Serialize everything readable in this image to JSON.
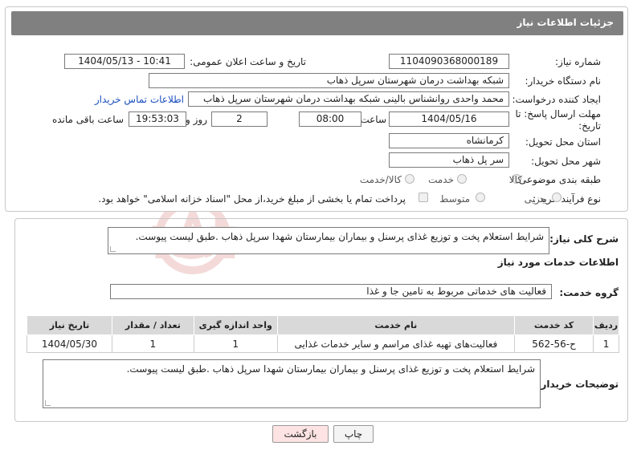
{
  "header": {
    "title": "جزئیات اطلاعات نیاز"
  },
  "form": {
    "need_number_label": "شماره نیاز:",
    "need_number": "1104090368000189",
    "announce_label": "تاریخ و ساعت اعلان عمومی:",
    "announce_value": "1404/05/13 - 10:41",
    "buyer_org_label": "نام دستگاه خریدار:",
    "buyer_org": "شبکه بهداشت درمان شهرستان سرپل ذهاب",
    "requester_label": "ایجاد کننده درخواست:",
    "requester": "محمد واحدی روانشناس بالینی شبکه بهداشت درمان شهرستان سرپل ذهاب",
    "contact_link": "اطلاعات تماس خریدار",
    "deadline_label_1": "مهلت ارسال پاسخ: تا",
    "deadline_label_2": "تاریخ:",
    "deadline_date": "1404/05/16",
    "time_label": "ساعت",
    "deadline_time": "08:00",
    "days_value": "2",
    "days_label": "روز و",
    "remaining_time": "19:53:03",
    "remaining_label": "ساعت باقی مانده",
    "province_label": "استان محل تحویل:",
    "province": "کرمانشاه",
    "city_label": "شهر محل تحویل:",
    "city": "سر پل ذهاب",
    "category_label": "طبقه بندی موضوعی:",
    "category_options": [
      "کالا",
      "خدمت",
      "کالا/خدمت"
    ],
    "process_label": "نوع فرآیند خرید :",
    "process_options": [
      "جزیی",
      "متوسط"
    ],
    "payment_note": "پرداخت تمام یا بخشی از مبلغ خرید،از محل \"اسناد خزانه اسلامی\" خواهد بود."
  },
  "details": {
    "summary_label": "شرح کلی نیاز:",
    "summary": "شرایط استعلام پخت و توزیع غذای پرسنل و بیماران بیمارستان شهدا سرپل ذهاب .طبق لیست پیوست.",
    "services_title": "اطلاعات خدمات مورد نیاز",
    "service_group_label": "گروه خدمت:",
    "service_group": "فعالیت های خدماتی مربوط به تامین جا و غذا",
    "table_headers": [
      "ردیف",
      "کد خدمت",
      "نام خدمت",
      "واحد اندازه گیری",
      "تعداد / مقدار",
      "تاریخ نیاز"
    ],
    "table_rows": [
      [
        "1",
        "ح-56-562",
        "فعالیت‌های تهیه غذای مراسم و سایر خدمات غذایی",
        "1",
        "1",
        "1404/05/30"
      ]
    ],
    "buyer_notes_label": "توضیحات خریدار:",
    "buyer_notes": "شرایط استعلام پخت و توزیع غذای پرسنل و بیماران بیمارستان شهدا سرپل ذهاب .طبق لیست پیوست."
  },
  "buttons": {
    "print": "چاپ",
    "back": "بازگشت"
  },
  "watermark": {
    "text": "AriaTender.net"
  },
  "colors": {
    "header": "#808080",
    "link": "#1a4fbf",
    "back_button": "#fde3e3",
    "watermark": "#c0392b"
  }
}
